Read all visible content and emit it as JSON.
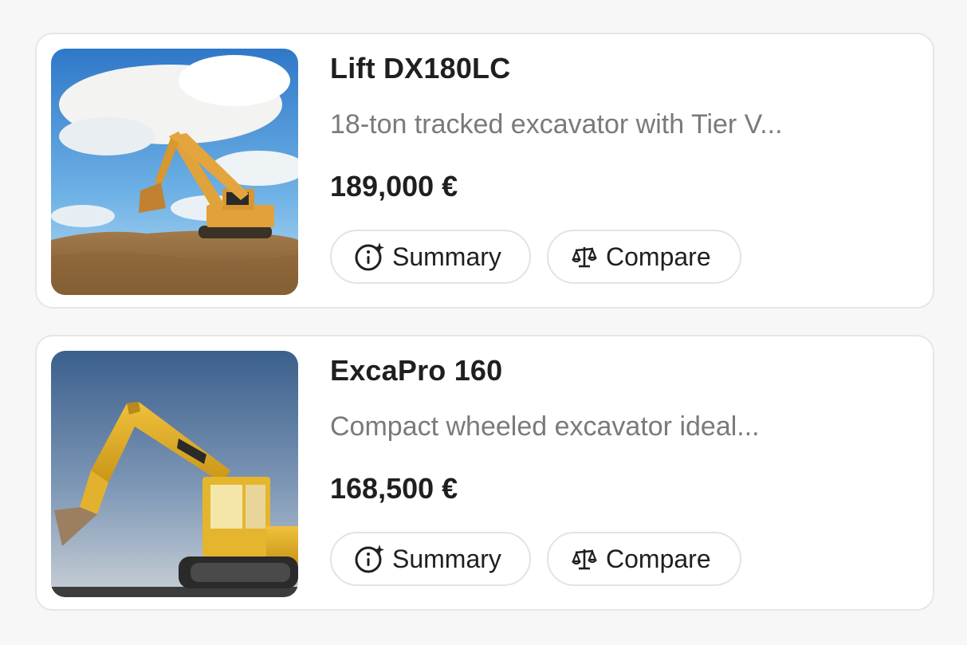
{
  "listings": [
    {
      "title": "Lift DX180LC",
      "description": "18-ton tracked excavator with Tier V...",
      "price": "189,000 €",
      "summary_label": "Summary",
      "compare_label": "Compare",
      "image": "excavator-on-dirt-mound"
    },
    {
      "title": "ExcaPro 160",
      "description": "Compact wheeled excavator ideal...",
      "price": "168,500 €",
      "summary_label": "Summary",
      "compare_label": "Compare",
      "image": "excavator-2017-blue-sky"
    }
  ],
  "icons": {
    "summary": "info-sparkle-icon",
    "compare": "scale-icon"
  },
  "colors": {
    "card_bg": "#ffffff",
    "border": "#e3e3e3",
    "text": "#1f1f1f",
    "muted": "#7a7a7a"
  }
}
